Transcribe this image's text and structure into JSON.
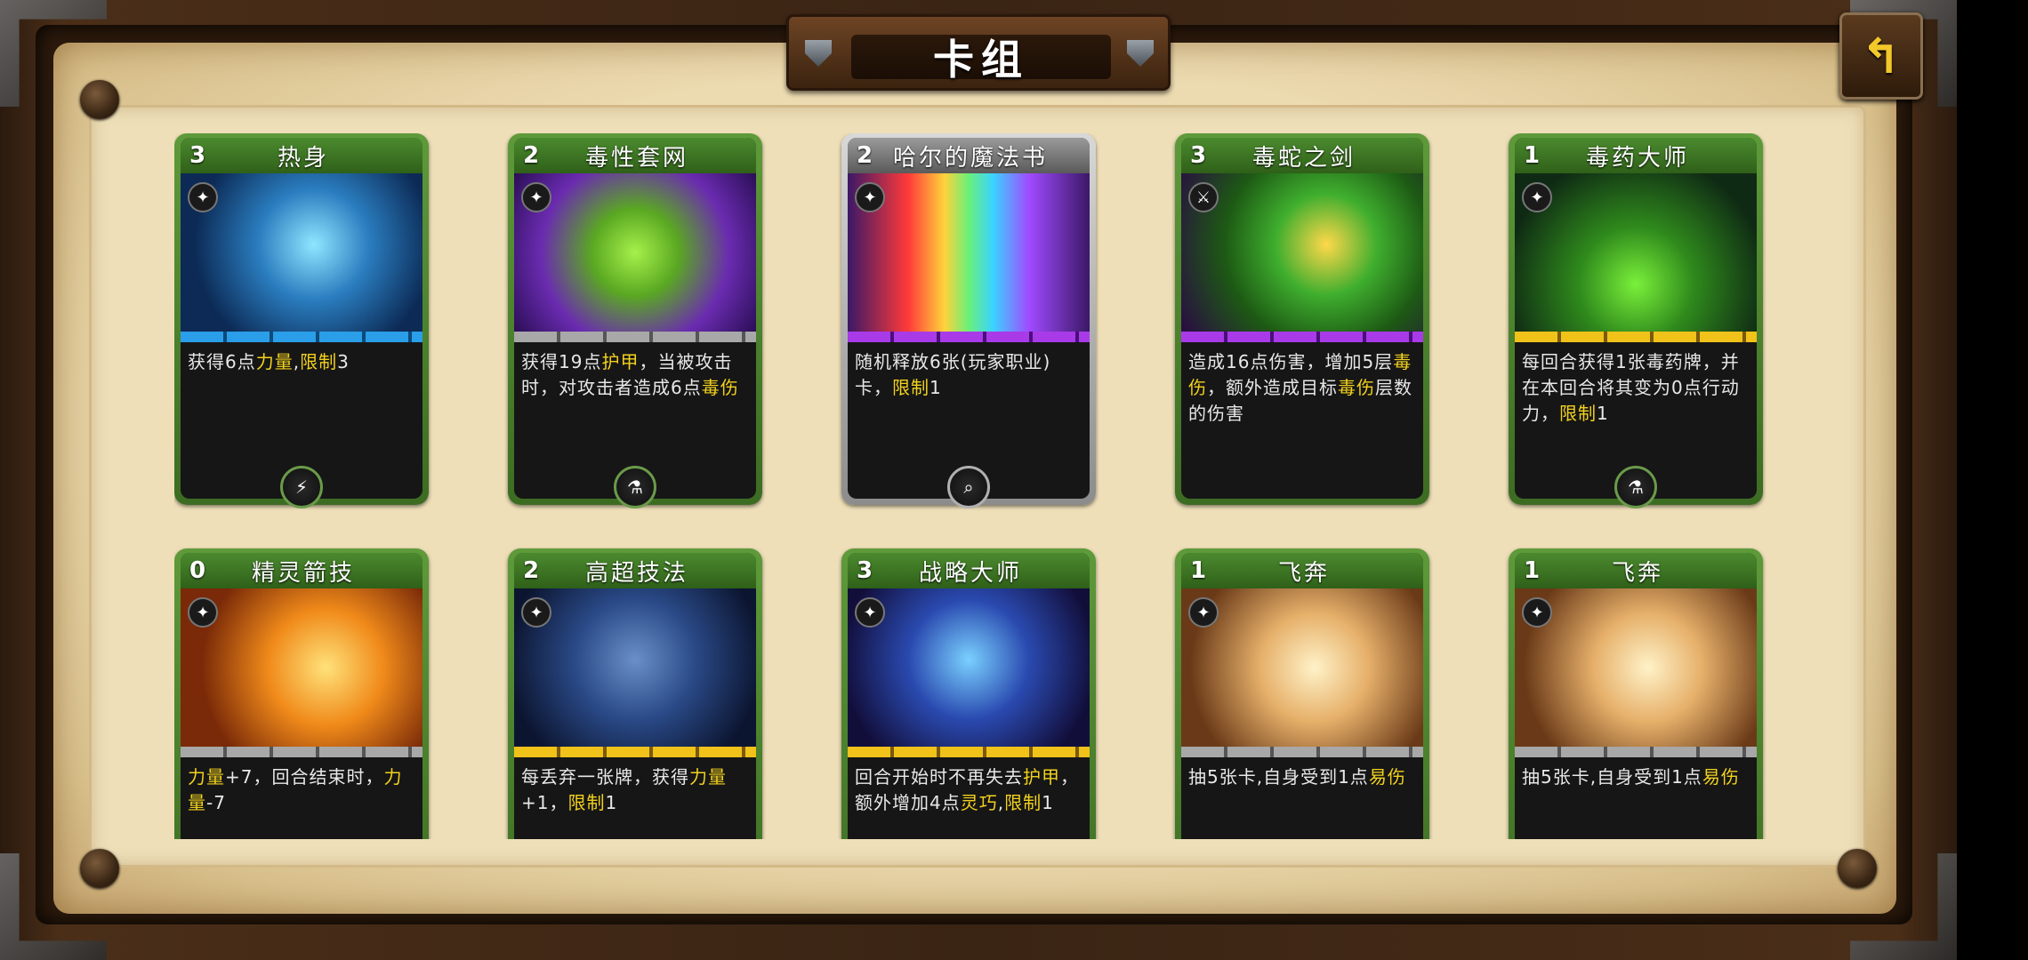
{
  "header": {
    "title": "卡组",
    "back_button": "back-arrow-icon"
  },
  "colors": {
    "card_green": "#4b8a2e",
    "card_silver": "#9a9a9a",
    "keyword_yellow": "#f2d21e",
    "back_arrow": "#f2c82a"
  },
  "cards": [
    {
      "cost": "3",
      "name": "热身",
      "icon": "sparkle-icon",
      "bar": "blue",
      "desc": [
        {
          "t": "获得6点"
        },
        {
          "t": "力量",
          "k": 1
        },
        {
          "t": ","
        },
        {
          "t": "限制",
          "k": 1
        },
        {
          "t": "3"
        }
      ],
      "badge": "lightning-rod-icon"
    },
    {
      "cost": "2",
      "name": "毒性套网",
      "icon": "sparkle-icon",
      "bar": "gray",
      "desc": [
        {
          "t": "获得19点"
        },
        {
          "t": "护甲",
          "k": 1
        },
        {
          "t": "，当被攻击时，对攻击者造成6点"
        },
        {
          "t": "毒伤",
          "k": 1
        }
      ],
      "badge": "potion-icon"
    },
    {
      "cost": "2",
      "name": "哈尔的魔法书",
      "icon": "sparkle-icon",
      "bar": "purple",
      "silver": true,
      "desc": [
        {
          "t": "随机释放6张(玩家职业)卡，"
        },
        {
          "t": "限制",
          "k": 1
        },
        {
          "t": "1"
        }
      ],
      "badge": "magnifier-icon"
    },
    {
      "cost": "3",
      "name": "毒蛇之剑",
      "icon": "sword-icon",
      "bar": "purple",
      "desc": [
        {
          "t": "造成16点伤害，增加5层"
        },
        {
          "t": "毒伤",
          "k": 1
        },
        {
          "t": "，额外造成目标"
        },
        {
          "t": "毒伤",
          "k": 1
        },
        {
          "t": "层数的伤害"
        }
      ],
      "badge": ""
    },
    {
      "cost": "1",
      "name": "毒药大师",
      "icon": "sparkle-icon",
      "bar": "yellow",
      "desc": [
        {
          "t": "每回合获得1张毒药牌，并在本回合将其变为0点行动力，"
        },
        {
          "t": "限制",
          "k": 1
        },
        {
          "t": "1"
        }
      ],
      "badge": "potion-icon"
    },
    {
      "cost": "0",
      "name": "精灵箭技",
      "icon": "sparkle-icon",
      "bar": "gray",
      "desc": [
        {
          "t": "力量",
          "k": 1
        },
        {
          "t": "+7，回合结束时，"
        },
        {
          "t": "力量",
          "k": 1
        },
        {
          "t": "-7"
        }
      ],
      "badge": ""
    },
    {
      "cost": "2",
      "name": "高超技法",
      "icon": "sparkle-icon",
      "bar": "yellow",
      "desc": [
        {
          "t": "每丢弃一张牌，获得"
        },
        {
          "t": "力量",
          "k": 1
        },
        {
          "t": "+1，"
        },
        {
          "t": "限制",
          "k": 1
        },
        {
          "t": "1"
        }
      ],
      "badge": ""
    },
    {
      "cost": "3",
      "name": "战略大师",
      "icon": "sparkle-icon",
      "bar": "yellow",
      "desc": [
        {
          "t": "回合开始时不再失去"
        },
        {
          "t": "护甲",
          "k": 1
        },
        {
          "t": "，额外增加4点"
        },
        {
          "t": "灵巧",
          "k": 1
        },
        {
          "t": ","
        },
        {
          "t": "限制",
          "k": 1
        },
        {
          "t": "1"
        }
      ],
      "badge": ""
    },
    {
      "cost": "1",
      "name": "飞奔",
      "icon": "sparkle-icon",
      "bar": "gray",
      "desc": [
        {
          "t": "抽5张卡,自身受到1点"
        },
        {
          "t": "易伤",
          "k": 1
        }
      ],
      "badge": ""
    },
    {
      "cost": "1",
      "name": "飞奔",
      "icon": "sparkle-icon",
      "bar": "gray",
      "desc": [
        {
          "t": "抽5张卡,自身受到1点"
        },
        {
          "t": "易伤",
          "k": 1
        }
      ],
      "badge": ""
    }
  ]
}
